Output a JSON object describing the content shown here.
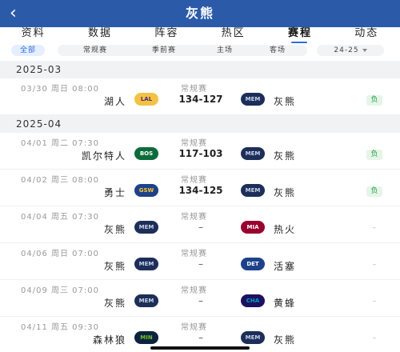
{
  "header": {
    "back_icon": "‹",
    "title": "灰熊"
  },
  "tabs": [
    "资料",
    "数据",
    "阵容",
    "热区",
    "赛程",
    "动态"
  ],
  "active_tab": "赛程",
  "filters": {
    "chips": [
      "全部",
      "常规赛",
      "季前赛",
      "主场",
      "客场"
    ],
    "season": "24-25"
  },
  "sections": [
    {
      "month": "2025-03",
      "games": [
        {
          "date": "03/30 周日 08:00",
          "type": "常规赛",
          "home": "湖人",
          "home_logo": "LAL",
          "score": "134-127",
          "away_logo": "MEM",
          "away": "灰熊",
          "result": "负"
        }
      ]
    },
    {
      "month": "2025-04",
      "games": [
        {
          "date": "04/01 周二 07:30",
          "type": "常规赛",
          "home": "凯尔特人",
          "home_logo": "BOS",
          "score": "117-103",
          "away_logo": "MEM",
          "away": "灰熊",
          "result": "负"
        },
        {
          "date": "04/02 周三 08:00",
          "type": "常规赛",
          "home": "勇士",
          "home_logo": "GSW",
          "score": "134-125",
          "away_logo": "MEM",
          "away": "灰熊",
          "result": "负"
        },
        {
          "date": "04/04 周五 07:30",
          "type": "常规赛",
          "home": "灰熊",
          "home_logo": "MEM",
          "score": "–",
          "away_logo": "MIA",
          "away": "热火",
          "result": "–"
        },
        {
          "date": "04/06 周日 07:00",
          "type": "常规赛",
          "home": "灰熊",
          "home_logo": "MEM",
          "score": "–",
          "away_logo": "DET",
          "away": "活塞",
          "result": "–"
        },
        {
          "date": "04/09 周三 07:00",
          "type": "常规赛",
          "home": "灰熊",
          "home_logo": "MEM",
          "score": "–",
          "away_logo": "CHA",
          "away": "黄蜂",
          "result": "–"
        },
        {
          "date": "04/11 周五 09:30",
          "type": "常规赛",
          "home": "森林狼",
          "home_logo": "MIN",
          "score": "–",
          "away_logo": "MEM",
          "away": "灰熊",
          "result": "–"
        }
      ]
    }
  ],
  "logo_colors": {
    "LAL": {
      "bg": "#f3c242",
      "fg": "#552583"
    },
    "MEM": {
      "bg": "#1d2e58",
      "fg": "#c6d3ea"
    },
    "BOS": {
      "bg": "#0d6b3a",
      "fg": "#ffffff"
    },
    "GSW": {
      "bg": "#1d428a",
      "fg": "#ffc72c"
    },
    "MIA": {
      "bg": "#98002e",
      "fg": "#ffffff"
    },
    "DET": {
      "bg": "#1d428a",
      "fg": "#ffffff"
    },
    "CHA": {
      "bg": "#1d1160",
      "fg": "#00a3c4"
    },
    "MIN": {
      "bg": "#0c2340",
      "fg": "#78be20"
    }
  },
  "colors": {
    "topbar": "#2b5aa8",
    "accent": "#2b6de1",
    "lose": "#2ba04a"
  }
}
